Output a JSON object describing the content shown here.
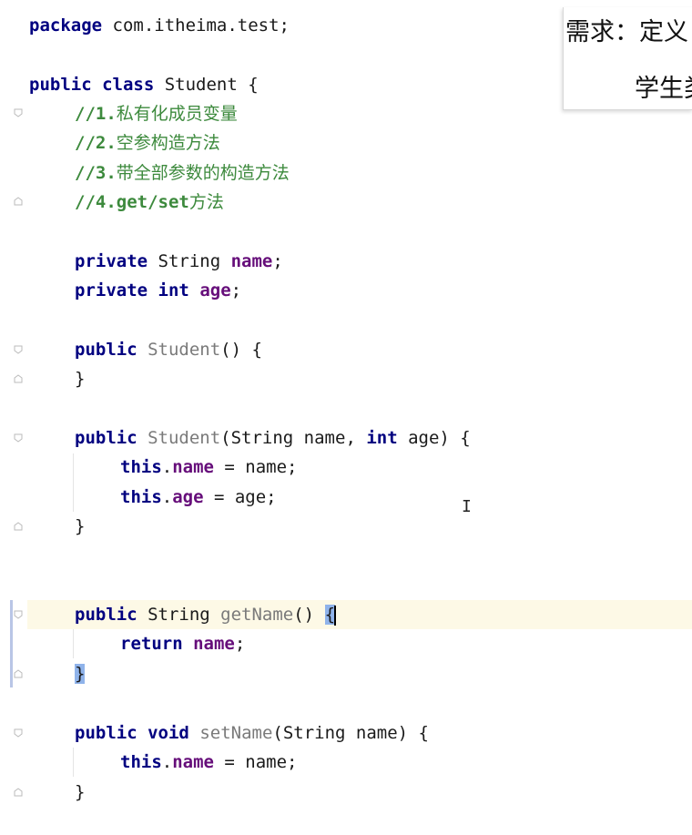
{
  "overlay": {
    "title": "需求：定义",
    "subtitle": "学生类"
  },
  "code": {
    "l1": {
      "kw": "package",
      "rest": " com.itheima.test;"
    },
    "l2": {
      "kw1": "public",
      "kw2": "class",
      "rest": " Student {"
    },
    "comments": [
      "//1.",
      "私有化成员变量",
      "//2.",
      "空参构造方法",
      "//3.",
      "带全部参数的构造方法",
      "//4.get/set",
      "方法"
    ],
    "field1": {
      "kw": "private",
      "type": " String ",
      "name": "name",
      "end": ";"
    },
    "field2": {
      "kw": "private",
      "type": "int",
      "name": "age",
      "end": ";"
    },
    "ctor1": {
      "kw": "public",
      "name": "Student",
      "rest": "() {"
    },
    "close": "}",
    "ctor2": {
      "kw": "public",
      "name": "Student",
      "p1": "(String name, ",
      "p2kw": "int",
      "p2": " age) {"
    },
    "assign_name": {
      "kw": "this",
      "dot": ".",
      "fld": "name",
      "rest": " = name;"
    },
    "assign_age": {
      "kw": "this",
      "dot": ".",
      "fld": "age",
      "rest": " = age;"
    },
    "getName": {
      "kw": "public",
      "type": " String ",
      "name": "getName",
      "rest": "() ",
      "brace": "{"
    },
    "ret": {
      "kw": "return",
      "fld": "name",
      "end": ";"
    },
    "setName": {
      "kw1": "public",
      "kw2": "void",
      "name": "setName",
      "rest": "(String name) {"
    }
  },
  "cursor_glyph": "I"
}
